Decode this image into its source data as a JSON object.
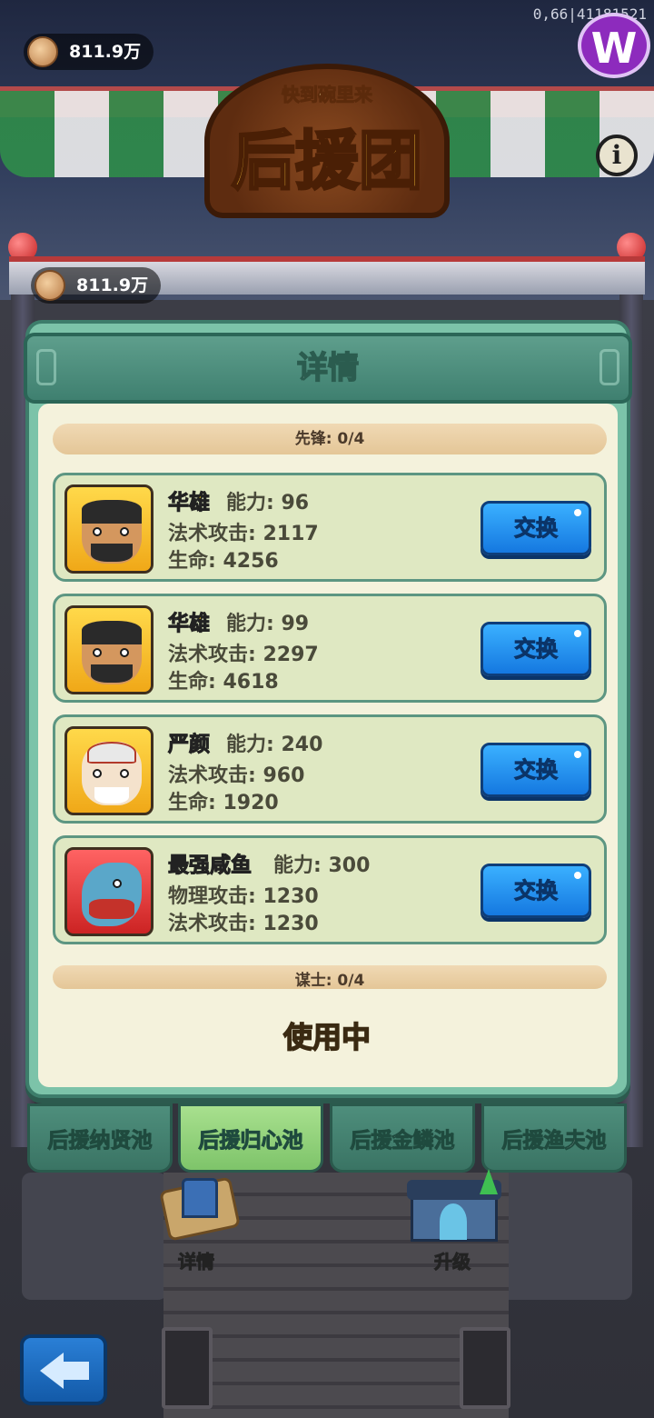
{
  "hud": {
    "coins_top": "811.9万",
    "coins_second": "811.9万",
    "version": "0,66|41181521"
  },
  "shop": {
    "subtitle": "快到碗里来",
    "title": "后援团"
  },
  "dialog": {
    "title": "详情",
    "group_vanguard": "先锋: 0/4",
    "group_strategist": "谋士: 0/4",
    "cards": [
      {
        "name": "华雄",
        "name_color": "yellow",
        "avatar_bg": "gold",
        "ability": "能力: 96",
        "stat1": "法术攻击: 2117",
        "stat2": "生命: 4256",
        "button": "交换"
      },
      {
        "name": "华雄",
        "name_color": "yellow",
        "avatar_bg": "gold",
        "ability": "能力: 99",
        "stat1": "法术攻击: 2297",
        "stat2": "生命: 4618",
        "button": "交换"
      },
      {
        "name": "严颜",
        "name_color": "yellow",
        "avatar_bg": "gold",
        "ability": "能力: 240",
        "stat1": "法术攻击: 960",
        "stat2": "生命: 1920",
        "button": "交换"
      },
      {
        "name": "最强咸鱼",
        "name_color": "red",
        "avatar_bg": "red",
        "ability": "能力: 300",
        "stat1": "物理攻击: 1230",
        "stat2": "法术攻击: 1230",
        "button": "交换"
      }
    ],
    "status": "使用中"
  },
  "tabs": [
    {
      "label": "后援纳贤池",
      "active": false
    },
    {
      "label": "后援归心池",
      "active": true
    },
    {
      "label": "后援金鳞池",
      "active": false
    },
    {
      "label": "后援渔夫池",
      "active": false
    }
  ],
  "bottom": {
    "details_label": "详情",
    "upgrade_label": "升级"
  },
  "icons": {
    "coin": "coin-icon",
    "info": "info-icon",
    "back": "back-arrow-icon",
    "logo": "w-logo-icon"
  },
  "colors": {
    "swap_button": "#1f8ff0",
    "dialog_frame": "#7cc3a9",
    "active_tab": "#8fd27a",
    "name_yellow": "#ffd815",
    "name_red": "#ff3a3a"
  }
}
